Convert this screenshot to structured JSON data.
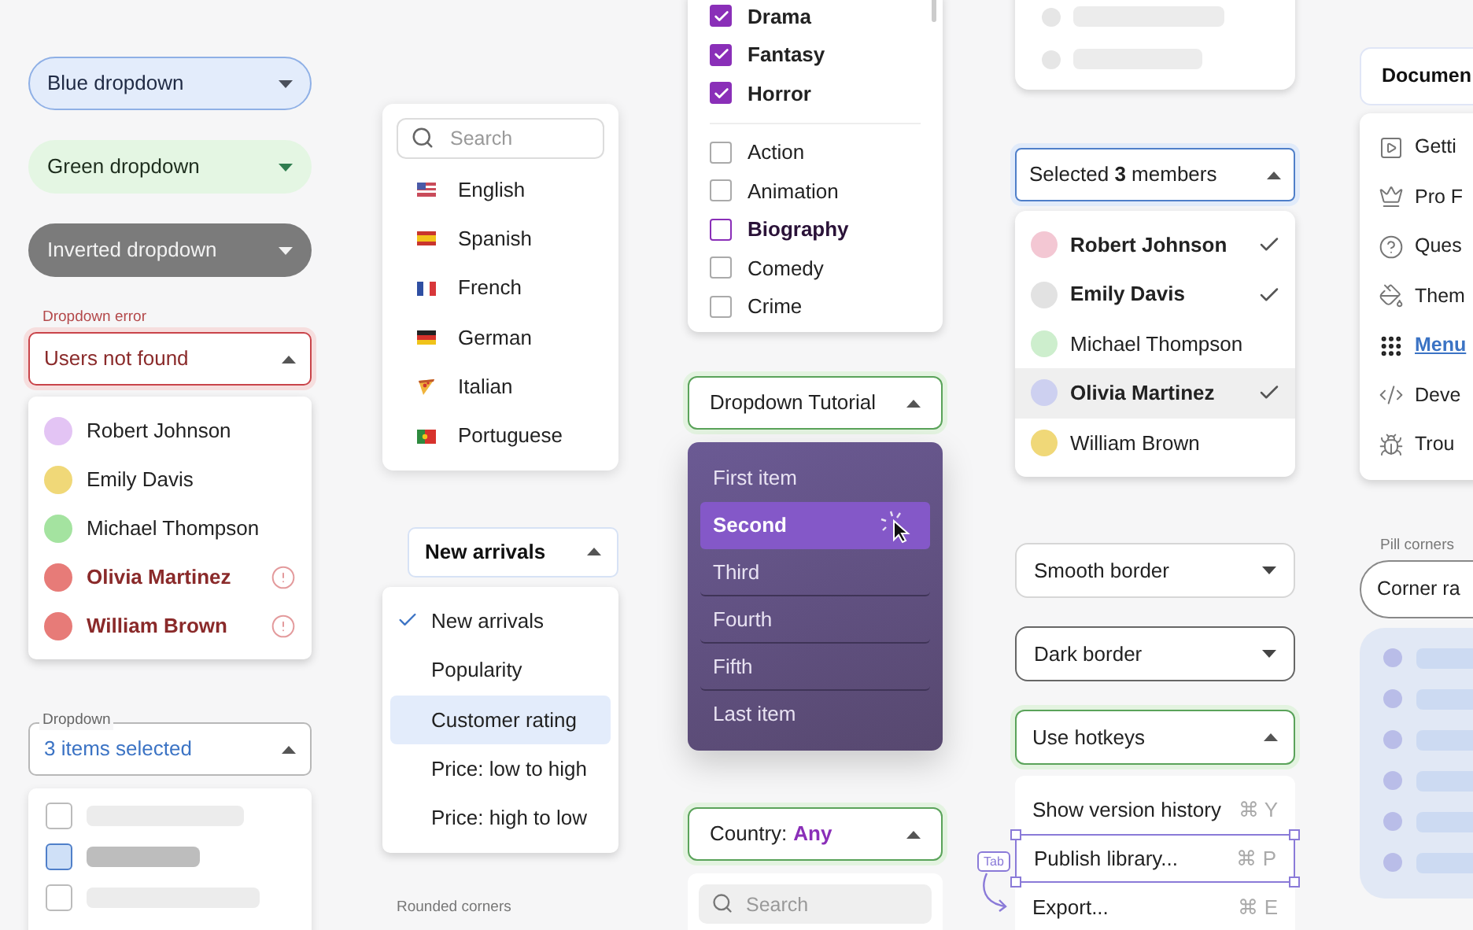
{
  "simple_dropdowns": [
    {
      "kind": "blue",
      "value": "Blue dropdown",
      "expanded": false
    },
    {
      "kind": "green",
      "value": "Green dropdown",
      "expanded": false
    },
    {
      "kind": "inverted",
      "value": "Inverted dropdown",
      "expanded": false
    }
  ],
  "error_dropdown": {
    "label": "Dropdown error",
    "value": "Users not found",
    "expanded": true,
    "options": [
      {
        "name": "Robert Johnson",
        "color": "#e3c4f4",
        "error": false
      },
      {
        "name": "Emily Davis",
        "color": "#f0d878",
        "error": false
      },
      {
        "name": "Michael Thompson",
        "color": "#a4e3a0",
        "error": false
      },
      {
        "name": "Olivia Martinez",
        "color": "#e77b78",
        "error": true
      },
      {
        "name": "William Brown",
        "color": "#e77b78",
        "error": true
      }
    ]
  },
  "multi_dropdown": {
    "label": "Dropdown",
    "value": "3 items selected",
    "expanded": true,
    "options": [
      {
        "checked": false
      },
      {
        "checked": true
      },
      {
        "checked": false
      }
    ]
  },
  "language_menu": {
    "search_placeholder": "Search",
    "items": [
      {
        "label": "English"
      },
      {
        "label": "Spanish"
      },
      {
        "label": "French"
      },
      {
        "label": "German"
      },
      {
        "label": "Italian"
      },
      {
        "label": "Portuguese"
      }
    ]
  },
  "sort_dropdown": {
    "value": "New arrivals",
    "expanded": true,
    "options": [
      {
        "label": "New arrivals",
        "selected": true,
        "highlighted": false
      },
      {
        "label": "Popularity",
        "selected": false,
        "highlighted": false
      },
      {
        "label": "Customer rating",
        "selected": false,
        "highlighted": true
      },
      {
        "label": "Price: low to high",
        "selected": false,
        "highlighted": false
      },
      {
        "label": "Price: high to low",
        "selected": false,
        "highlighted": false
      }
    ]
  },
  "caption_rounded": "Rounded corners",
  "genre_menu": {
    "groups": [
      {
        "items": [
          {
            "label": "Drama",
            "checked": true,
            "focused": false
          },
          {
            "label": "Fantasy",
            "checked": true,
            "focused": false
          },
          {
            "label": "Horror",
            "checked": true,
            "focused": false
          }
        ]
      },
      {
        "items": [
          {
            "label": "Action",
            "checked": false,
            "focused": false
          },
          {
            "label": "Animation",
            "checked": false,
            "focused": false
          },
          {
            "label": "Biography",
            "checked": false,
            "focused": true
          },
          {
            "label": "Comedy",
            "checked": false,
            "focused": false
          },
          {
            "label": "Crime",
            "checked": false,
            "focused": false
          }
        ]
      }
    ]
  },
  "tutorial_dropdown": {
    "value": "Dropdown Tutorial",
    "expanded": true,
    "items": [
      {
        "label": "First item",
        "selected": false
      },
      {
        "label": "Second",
        "selected": true
      },
      {
        "label": "Third",
        "selected": false
      },
      {
        "label": "Fourth",
        "selected": false
      },
      {
        "label": "Fifth",
        "selected": false
      },
      {
        "label": "Last item",
        "selected": false
      }
    ]
  },
  "country_dropdown": {
    "label": "Country:",
    "value": "Any",
    "expanded": true,
    "search_placeholder": "Search"
  },
  "members_dropdown": {
    "value": "Selected **3** members",
    "expanded": true,
    "options": [
      {
        "name": "Robert Johnson",
        "color": "#f3c7d3",
        "selected": true,
        "highlighted": false
      },
      {
        "name": "Emily Davis",
        "color": "#e2e2e2",
        "selected": true,
        "highlighted": false
      },
      {
        "name": "Michael Thompson",
        "color": "#cdeecd",
        "selected": false,
        "highlighted": false
      },
      {
        "name": "Olivia Martinez",
        "color": "#cdd0f0",
        "selected": true,
        "highlighted": true
      },
      {
        "name": "William Brown",
        "color": "#f0d878",
        "selected": false,
        "highlighted": false
      }
    ]
  },
  "border_dropdowns": [
    {
      "kind": "smooth",
      "value": "Smooth border",
      "expanded": false
    },
    {
      "kind": "dark",
      "value": "Dark border",
      "expanded": false
    }
  ],
  "hotkeys_dropdown": {
    "value": "Use hotkeys",
    "expanded": true,
    "tab_hint": "Tab",
    "items": [
      {
        "label": "Show version history",
        "shortcut": "⌘ Y",
        "focused": false
      },
      {
        "label": "Publish library...",
        "shortcut": "⌘ P",
        "focused": true
      },
      {
        "label": "Export...",
        "shortcut": "⌘ E",
        "focused": false
      }
    ]
  },
  "docs_dropdown": {
    "value": "Documen",
    "items": [
      {
        "label": "Getti",
        "selected": false
      },
      {
        "label": "Pro F",
        "selected": false
      },
      {
        "label": "Ques",
        "selected": false
      },
      {
        "label": "Them",
        "selected": false
      },
      {
        "label": "Menu",
        "selected": true
      },
      {
        "label": "Deve",
        "selected": false
      },
      {
        "label": "Trou",
        "selected": false
      }
    ]
  },
  "pill_dropdown": {
    "label": "Pill corners",
    "value": "Corner ra"
  }
}
